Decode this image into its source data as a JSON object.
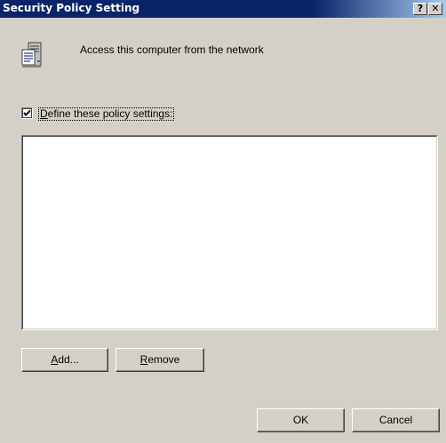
{
  "window": {
    "title": "Security Policy Setting",
    "help_glyph": "?",
    "close_glyph": "✕"
  },
  "policy": {
    "name": "Access this computer from the network",
    "icon": "policy-server-icon"
  },
  "define_settings": {
    "checked": true,
    "label_mnemonic": "D",
    "label_rest": "efine these policy settings:"
  },
  "user_list": {
    "items": []
  },
  "buttons": {
    "add_mnemonic": "A",
    "add_rest": "dd...",
    "remove_mnemonic": "R",
    "remove_rest": "emove",
    "ok": "OK",
    "cancel": "Cancel"
  },
  "colors": {
    "titlebar": "#0a246a",
    "face": "#d4d0c8"
  }
}
